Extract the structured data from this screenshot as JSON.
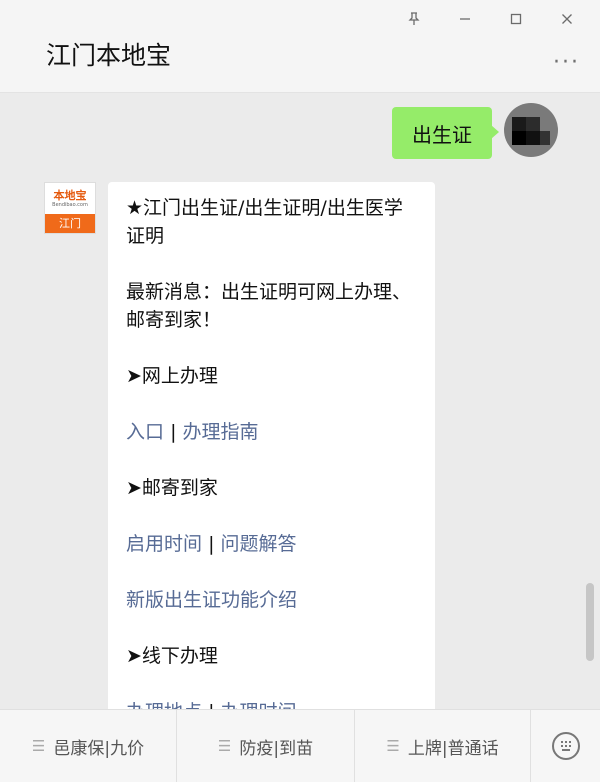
{
  "window": {
    "title": "江门本地宝",
    "controls": [
      "pin-icon",
      "minimize-icon",
      "maximize-icon",
      "close-icon"
    ],
    "more_label": "···"
  },
  "chat": {
    "user_message": "出生证",
    "bot_logo": {
      "top_text": "本地宝",
      "sub_text": "Bendibao.com",
      "city": "江门"
    },
    "reply": {
      "title": "★江门出生证/出生证明/出生医学证明",
      "news": "最新消息：出生证明可网上办理、邮寄到家！",
      "online_heading": "➤网上办理",
      "online_links": [
        "入口",
        "办理指南"
      ],
      "mail_heading": "➤邮寄到家",
      "mail_links": [
        "启用时间",
        "问题解答"
      ],
      "new_feature_link": "新版出生证功能介绍",
      "offline_heading": "➤线下办理",
      "offline_links": [
        "办理地点",
        "办理时间"
      ],
      "separator": "|"
    }
  },
  "menu": {
    "items": [
      "邑康保|九价",
      "防疫|到苗",
      "上牌|普通话"
    ],
    "menu_icon": "menu-lines-icon",
    "keyboard_icon": "keyboard-icon"
  },
  "colors": {
    "my_bubble": "#95ec69",
    "link": "#576b95",
    "chat_bg": "#ebebeb",
    "logo_orange": "#f06a1a"
  }
}
